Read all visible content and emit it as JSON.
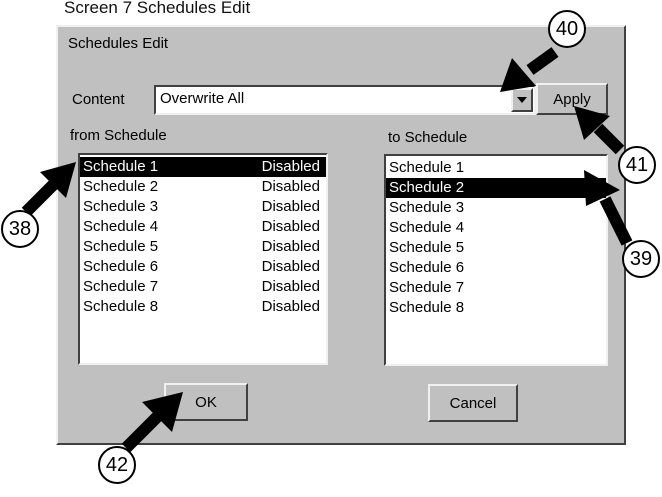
{
  "caption": "Screen 7 Schedules Edit",
  "dialog": {
    "title": "Schedules Edit",
    "content_label": "Content",
    "content_value": "Overwrite All",
    "apply_label": "Apply",
    "from_label": "from Schedule",
    "to_label": "to Schedule",
    "from_items": [
      {
        "name": "Schedule 1",
        "status": "Disabled"
      },
      {
        "name": "Schedule 2",
        "status": "Disabled"
      },
      {
        "name": "Schedule 3",
        "status": "Disabled"
      },
      {
        "name": "Schedule 4",
        "status": "Disabled"
      },
      {
        "name": "Schedule 5",
        "status": "Disabled"
      },
      {
        "name": "Schedule 6",
        "status": "Disabled"
      },
      {
        "name": "Schedule 7",
        "status": "Disabled"
      },
      {
        "name": "Schedule 8",
        "status": "Disabled"
      }
    ],
    "from_selected": "Schedule 1",
    "to_items": [
      "Schedule 1",
      "Schedule 2",
      "Schedule 3",
      "Schedule 4",
      "Schedule 5",
      "Schedule 6",
      "Schedule 7",
      "Schedule 8"
    ],
    "to_selected": "Schedule 2",
    "ok_label": "OK",
    "cancel_label": "Cancel"
  },
  "callouts": [
    "38",
    "39",
    "40",
    "41",
    "42"
  ],
  "colors": {
    "dialog_bg": "#c0c0c0",
    "selection": "#000000"
  }
}
